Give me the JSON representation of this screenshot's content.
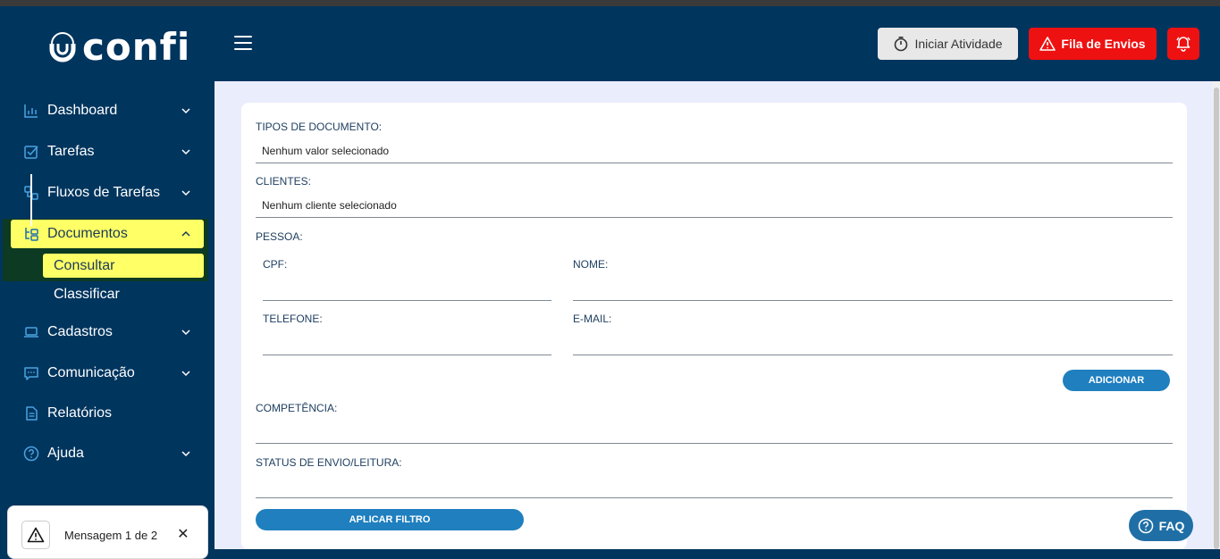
{
  "header": {
    "logo_text": "confi",
    "iniciar_label": "Iniciar Atividade",
    "fila_label": "Fila de Envios"
  },
  "sidebar": {
    "items": [
      {
        "label": "Dashboard"
      },
      {
        "label": "Tarefas"
      },
      {
        "label": "Fluxos de Tarefas"
      },
      {
        "label": "Documentos"
      },
      {
        "label": "Cadastros"
      },
      {
        "label": "Comunicação"
      },
      {
        "label": "Relatórios"
      },
      {
        "label": "Ajuda"
      }
    ],
    "documentos_sub": [
      {
        "label": "Consultar"
      },
      {
        "label": "Classificar"
      }
    ]
  },
  "form": {
    "tipos_label": "TIPOS DE DOCUMENTO:",
    "tipos_value": "Nenhum valor selecionado",
    "clientes_label": "CLIENTES:",
    "clientes_value": "Nenhum cliente selecionado",
    "pessoa_label": "PESSOA:",
    "cpf_label": "CPF:",
    "nome_label": "NOME:",
    "telefone_label": "TELEFONE:",
    "email_label": "E-MAIL:",
    "adicionar_label": "ADICIONAR",
    "competencia_label": "COMPETÊNCIA:",
    "status_label": "STATUS DE ENVIO/LEITURA:",
    "aplicar_label": "APLICAR FILTRO"
  },
  "faq_label": "FAQ",
  "toast": {
    "message": "Mensagem 1 de 2",
    "close": "✕"
  },
  "colors": {
    "navy": "#00355e",
    "highlight": "#ffff66",
    "danger": "#ee1111",
    "primary_button": "#1f7fbf",
    "content_bg": "#eaeefc"
  }
}
